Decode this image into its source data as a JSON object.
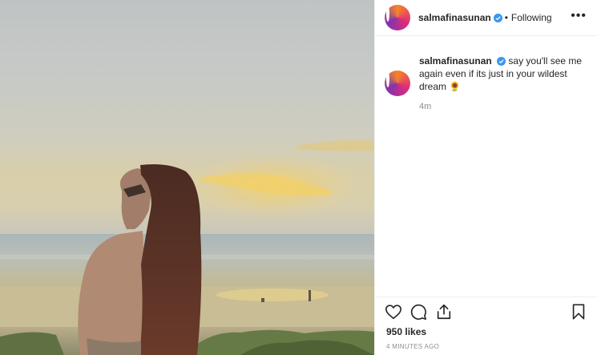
{
  "post": {
    "photo_description_icon": "photo",
    "header": {
      "username": "salmafinasunan",
      "verified_icon": "verified-badge-icon",
      "separator": "•",
      "follow_status": "Following",
      "more_label": "•••"
    },
    "caption": {
      "username": "salmafinasunan",
      "text": "say you'll see me again even if its just in your wildest dream 🌻",
      "age": "4m"
    },
    "actions": {
      "like_icon": "heart-icon",
      "comment_icon": "comment-icon",
      "share_icon": "share-icon",
      "save_icon": "bookmark-icon"
    },
    "likes": "950 likes",
    "timestamp": "4 MINUTES AGO"
  },
  "colors": {
    "verified": "#3897f0",
    "text": "#262626",
    "muted": "#8e8e8e",
    "divider": "#efefef"
  }
}
